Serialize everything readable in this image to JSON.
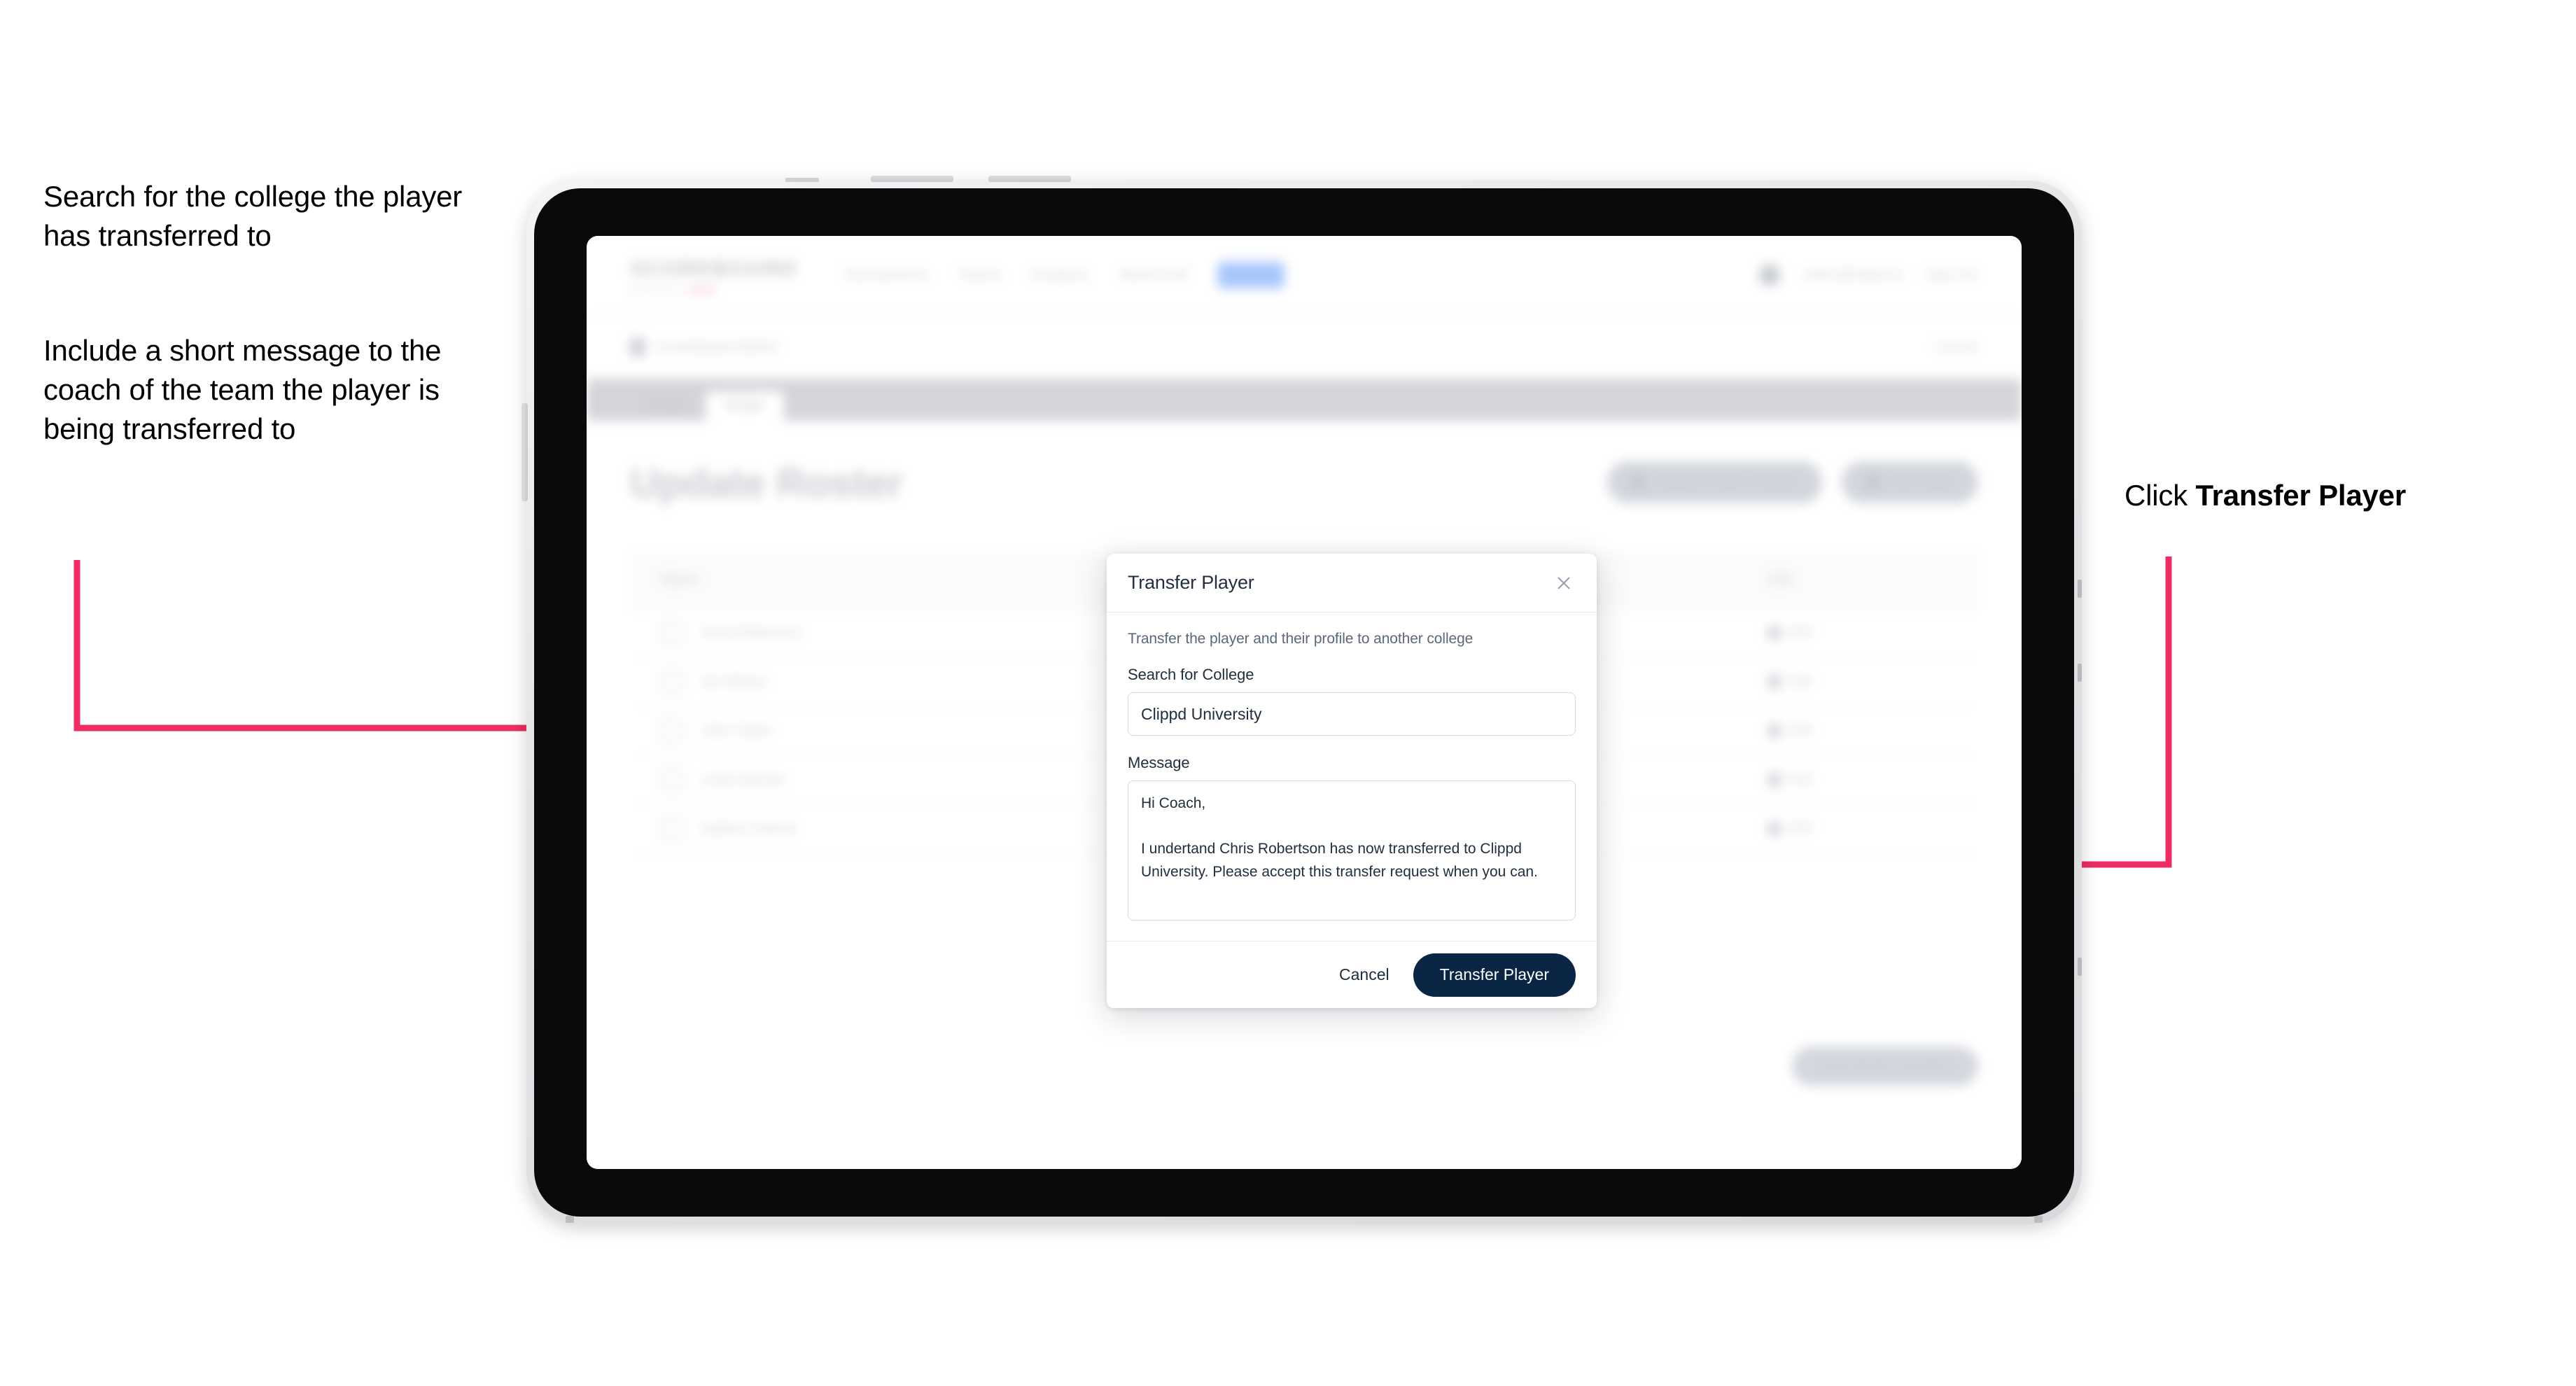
{
  "annotations": {
    "left_1": "Search for the college the player has transferred to",
    "left_2": "Include a short message to the coach of the team the player is being transferred to",
    "right_1_prefix": "Click ",
    "right_1_bold": "Transfer Player"
  },
  "colors": {
    "arrow_pink": "#ED2D63",
    "primary_navy": "#0B2545",
    "accent_blue": "#A8C7FA",
    "brand_accent": "#F6A9BF"
  },
  "app": {
    "brand": {
      "word": "SCOREBOARD",
      "sub": "powered by",
      "sub_accent": "clippd"
    },
    "nav_links": [
      {
        "label": "Tournaments",
        "active": false
      },
      {
        "label": "Teams",
        "active": false
      },
      {
        "label": "Analytics",
        "active": false
      },
      {
        "label": "World Golf",
        "active": false
      },
      {
        "label": "Admin",
        "active": true
      }
    ],
    "nav_right": {
      "user": "admin@clippd.io",
      "sign_out": "Sign Out"
    },
    "breadcrumb": {
      "label": "Scoreboard Admin",
      "right_action": "Cancel"
    },
    "tabs": [
      {
        "label": "Details",
        "active": false
      },
      {
        "label": "Roster",
        "active": true
      }
    ],
    "page_title": "Update Roster",
    "page_actions": [
      {
        "label": "Request Player Transfer",
        "icon": "transfer-icon"
      },
      {
        "label": "Add Player",
        "icon": "plus-icon"
      }
    ],
    "roster_table": {
      "columns": [
        "Name",
        "Edit"
      ],
      "rows": [
        {
          "name": "Chris Robertson",
          "action": "Edit"
        },
        {
          "name": "Ian Wilson",
          "action": "Edit"
        },
        {
          "name": "John Taylor",
          "action": "Edit"
        },
        {
          "name": "Lewis Barnes",
          "action": "Edit"
        },
        {
          "name": "Nathan Holmes",
          "action": "Edit"
        }
      ]
    },
    "bottom_action": "Save Roster Changes"
  },
  "modal": {
    "title": "Transfer Player",
    "close_icon": "close-icon",
    "description": "Transfer the player and their profile to another college",
    "college_field": {
      "label": "Search for College",
      "value": "Clippd University",
      "placeholder": "Search for College"
    },
    "message_field": {
      "label": "Message",
      "value": "Hi Coach,\n\nI undertand Chris Robertson has now transferred to Clippd University. Please accept this transfer request when you can.",
      "placeholder": "Message"
    },
    "cancel_label": "Cancel",
    "submit_label": "Transfer Player"
  }
}
